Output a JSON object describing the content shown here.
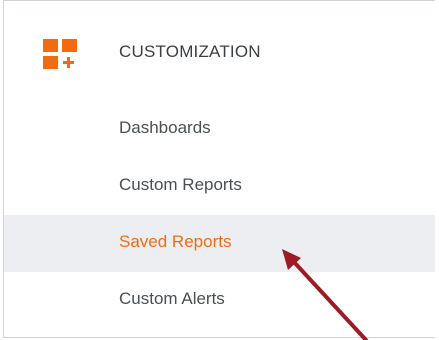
{
  "section": {
    "title": "CUSTOMIZATION",
    "icon": "customization-grid-plus-icon",
    "accent_color": "#f26b10"
  },
  "menu": {
    "items": [
      {
        "label": "Dashboards",
        "selected": false
      },
      {
        "label": "Custom Reports",
        "selected": false
      },
      {
        "label": "Saved Reports",
        "selected": true
      },
      {
        "label": "Custom Alerts",
        "selected": false
      }
    ]
  },
  "annotation": {
    "type": "arrow",
    "color": "#9b1c24",
    "points_to": "Saved Reports"
  }
}
